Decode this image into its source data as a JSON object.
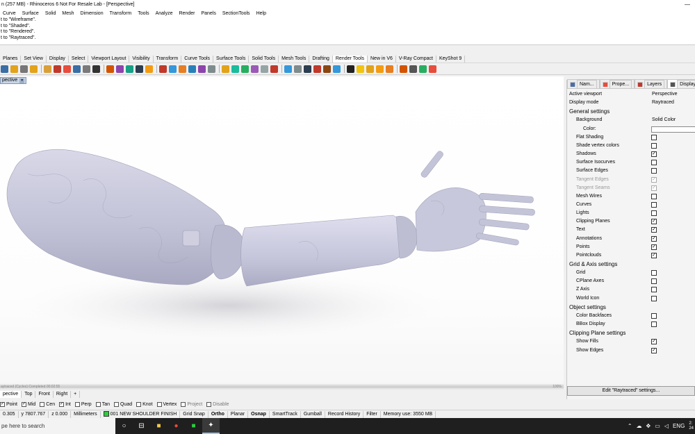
{
  "window": {
    "title": "n (257 MB) - Rhinoceros 6 Not For Resale Lab - [Perspective]",
    "minimize_glyph": "—"
  },
  "menu": [
    "Curve",
    "Surface",
    "Solid",
    "Mesh",
    "Dimension",
    "Transform",
    "Tools",
    "Analyze",
    "Render",
    "Panels",
    "SectionTools",
    "Help"
  ],
  "command_history": [
    "t to \"Wireframe\".",
    "t to \"Shaded\".",
    "t to \"Rendered\".",
    "t to \"Raytraced\"."
  ],
  "toolbar_tabs": [
    "Planes",
    "Set View",
    "Display",
    "Select",
    "Viewport Layout",
    "Visibility",
    "Transform",
    "Curve Tools",
    "Surface Tools",
    "Solid Tools",
    "Mesh Tools",
    "Drafting",
    "Render Tools",
    "New in V6",
    "V-Ray Compact",
    "KeyShot 9"
  ],
  "toolbar_tabs_active": 12,
  "toolbar_icon_colors": [
    "#3a6ea5",
    "#e2a21a",
    "#777777",
    "#e2a21a",
    "#d9a03a",
    "#c0392b",
    "#e74c3c",
    "#3a6ea5",
    "#7a7a7a",
    "#333333",
    "#d35400",
    "#8e44ad",
    "#16a085",
    "#2c3e50",
    "#f39c12",
    "#c0392b",
    "#3498db",
    "#e67e22",
    "#2980b9",
    "#8e44ad",
    "#7f8c8d",
    "#e2a21a",
    "#1abc9c",
    "#27ae60",
    "#9b59b6",
    "#95a5a6",
    "#c0392b",
    "#3498db",
    "#7f8c8d",
    "#2c3e50",
    "#c0392b",
    "#8b4513",
    "#3498db",
    "#222222",
    "#f1c40f",
    "#e2a21a",
    "#f39c12",
    "#e67e22",
    "#d35400",
    "#555555",
    "#27ae60",
    "#e74c3c"
  ],
  "viewport": {
    "name": "pective",
    "status": "aytraced (Cycles)  Completed  00:02:55",
    "status_progress": 1.0,
    "status_right": "100%"
  },
  "viewport_tabs": [
    "pective",
    "Top",
    "Front",
    "Right"
  ],
  "viewport_tab_add": "+",
  "osnaps": [
    {
      "label": "Point",
      "checked": true
    },
    {
      "label": "Mid",
      "checked": true
    },
    {
      "label": "Cen",
      "checked": false
    },
    {
      "label": "Int",
      "checked": true
    },
    {
      "label": "Perp",
      "checked": false
    },
    {
      "label": "Tan",
      "checked": false
    },
    {
      "label": "Quad",
      "checked": false
    },
    {
      "label": "Knot",
      "checked": false
    },
    {
      "label": "Vertex",
      "checked": false
    },
    {
      "label": "Project",
      "checked": false
    },
    {
      "label": "Disable",
      "checked": false
    }
  ],
  "statusbar": {
    "x": "0.305",
    "y": "y 7807.767",
    "z": "z 0.000",
    "units": "Millimeters",
    "layer": "001 NEW SHOULDER FINISH",
    "layer_color": "#2ecc40",
    "toggles": [
      "Grid Snap",
      "Ortho",
      "Planar",
      "Osnap",
      "SmartTrack",
      "Gumball",
      "Record History",
      "Filter"
    ],
    "bold_toggles": [
      "Ortho",
      "Osnap"
    ],
    "memory": "Memory use: 3550 MB"
  },
  "taskbar": {
    "search_placeholder": "pe here to search",
    "tray_lang": "ENG",
    "clock": "2:\n24"
  },
  "panel": {
    "tabs": [
      {
        "label": "Nam...",
        "color": "#4a6fa5"
      },
      {
        "label": "Prope...",
        "color": "#e74c3c"
      },
      {
        "label": "Layers",
        "color": "#c0392b"
      },
      {
        "label": "Display",
        "color": "#555555"
      },
      {
        "label": "Help",
        "color": "#3a6ea5"
      }
    ],
    "active_tab": 3,
    "active_viewport_label": "Active viewport",
    "active_viewport_value": "Perspective",
    "display_mode_label": "Display mode",
    "display_mode_value": "Raytraced",
    "sections": {
      "general": "General settings",
      "grid": "Grid & Axis settings",
      "object": "Object settings",
      "clipping": "Clipping Plane settings"
    },
    "background_label": "Background",
    "background_value": "Solid Color",
    "color_label": "Color:",
    "general_items": [
      {
        "label": "Flat Shading",
        "checked": false,
        "disabled": false
      },
      {
        "label": "Shade vertex colors",
        "checked": false,
        "disabled": false
      },
      {
        "label": "Shadows",
        "checked": true,
        "disabled": false
      },
      {
        "label": "Surface Isocurves",
        "checked": false,
        "disabled": false
      },
      {
        "label": "Surface Edges",
        "checked": false,
        "disabled": false
      },
      {
        "label": "Tangent Edges",
        "checked": true,
        "disabled": true
      },
      {
        "label": "Tangent Seams",
        "checked": true,
        "disabled": true
      },
      {
        "label": "Mesh Wires",
        "checked": false,
        "disabled": false
      },
      {
        "label": "Curves",
        "checked": false,
        "disabled": false
      },
      {
        "label": "Lights",
        "checked": false,
        "disabled": false
      },
      {
        "label": "Clipping Planes",
        "checked": true,
        "disabled": false
      },
      {
        "label": "Text",
        "checked": true,
        "disabled": false
      },
      {
        "label": "Annotations",
        "checked": true,
        "disabled": false
      },
      {
        "label": "Points",
        "checked": true,
        "disabled": false
      },
      {
        "label": "Pointclouds",
        "checked": true,
        "disabled": false
      }
    ],
    "grid_items": [
      {
        "label": "Grid",
        "checked": false
      },
      {
        "label": "CPlane Axes",
        "checked": false
      },
      {
        "label": "Z Axis",
        "checked": false
      },
      {
        "label": "World Icon",
        "checked": false
      }
    ],
    "object_items": [
      {
        "label": "Color Backfaces",
        "checked": false
      },
      {
        "label": "BBox Display",
        "checked": false
      }
    ],
    "clipping_items": [
      {
        "label": "Show Fills",
        "checked": true
      },
      {
        "label": "Show Edges",
        "checked": true
      }
    ],
    "edit_button": "Edit \"Raytraced\" settings..."
  }
}
